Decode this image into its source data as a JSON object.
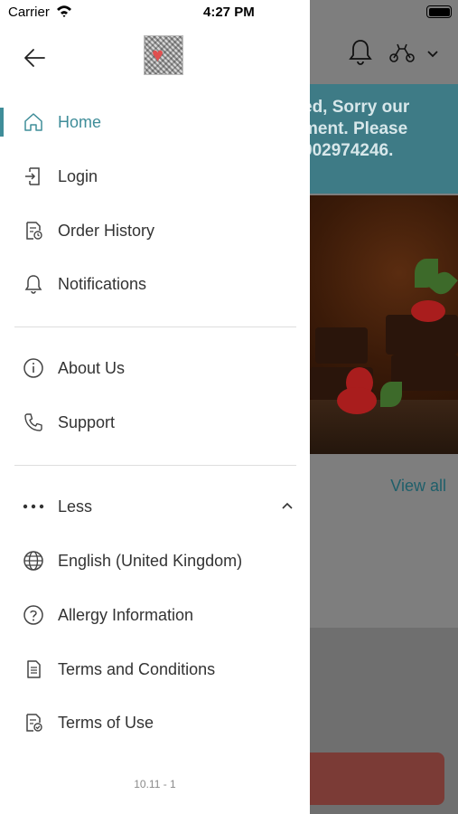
{
  "status_bar": {
    "carrier": "Carrier",
    "time": "4:27 PM"
  },
  "background": {
    "banner_lines": [
      "ed, Sorry our",
      "ment. Please",
      "902974246."
    ],
    "view_all": "View all"
  },
  "drawer": {
    "logo_alt": "restaurant-logo",
    "items": [
      {
        "label": "Home",
        "icon": "home-icon",
        "active": true
      },
      {
        "label": "Login",
        "icon": "login-icon"
      },
      {
        "label": "Order History",
        "icon": "order-history-icon"
      },
      {
        "label": "Notifications",
        "icon": "bell-icon"
      }
    ],
    "items2": [
      {
        "label": "About Us",
        "icon": "info-icon"
      },
      {
        "label": "Support",
        "icon": "phone-icon"
      }
    ],
    "more_toggle": {
      "label": "Less",
      "icon": "ellipsis-icon"
    },
    "items3": [
      {
        "label": "English (United Kingdom)",
        "icon": "globe-icon"
      },
      {
        "label": "Allergy Information",
        "icon": "question-icon"
      },
      {
        "label": "Terms and Conditions",
        "icon": "document-icon"
      },
      {
        "label": "Terms of Use",
        "icon": "document-check-icon"
      }
    ],
    "version": "10.11 - 1"
  },
  "colors": {
    "accent": "#3f8d99",
    "banner": "#3e7b86"
  }
}
